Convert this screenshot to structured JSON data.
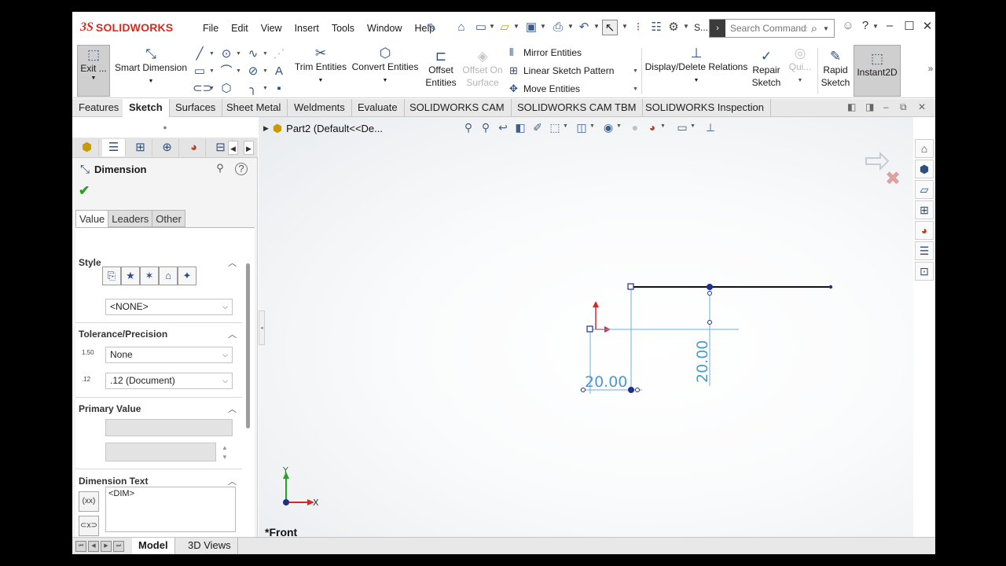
{
  "app": {
    "logo_mark": "3S",
    "logo_text": "SOLIDWORKS"
  },
  "menu": [
    "File",
    "Edit",
    "View",
    "Insert",
    "Tools",
    "Window",
    "Help"
  ],
  "toolbar": {
    "s_label": "S...",
    "search_placeholder": "Search Commands"
  },
  "ribbon": {
    "exit_label": "Exit ...",
    "smart_dimension": "Smart Dimension",
    "trim_entities": "Trim Entities",
    "convert_entities": "Convert Entities",
    "offset_entities_1": "Offset",
    "offset_entities_2": "Entities",
    "offset_surface_1": "Offset On",
    "offset_surface_2": "Surface",
    "mirror_entities": "Mirror Entities",
    "linear_pattern": "Linear Sketch Pattern",
    "move_entities": "Move Entities",
    "display_delete": "Display/Delete Relations",
    "repair_1": "Repair",
    "repair_2": "Sketch",
    "quick": "Qui...",
    "rapid_1": "Rapid",
    "rapid_2": "Sketch",
    "instant2d": "Instant2D",
    "more": "»"
  },
  "tabs": [
    "Features",
    "Sketch",
    "Surfaces",
    "Sheet Metal",
    "Weldments",
    "Evaluate",
    "SOLIDWORKS CAM",
    "SOLIDWORKS CAM TBM",
    "SOLIDWORKS Inspection"
  ],
  "active_tab": "Sketch",
  "property_manager": {
    "title": "Dimension",
    "subtabs": [
      "Value",
      "Leaders",
      "Other"
    ],
    "style": {
      "title": "Style",
      "value": "<NONE>"
    },
    "tolerance": {
      "title": "Tolerance/Precision",
      "tol_value": "None",
      "precision_value": ".12 (Document)",
      "tol_icon_text": "1.50",
      "prec_icon_text": ".12"
    },
    "primary_value": {
      "title": "Primary Value"
    },
    "dimension_text": {
      "title": "Dimension Text",
      "value": "<DIM>"
    }
  },
  "graphics": {
    "tree_label": "Part2  (Default<<De...",
    "view_label": "*Front",
    "dim_horizontal": "20.00",
    "dim_vertical": "20.00",
    "triad_x": "X",
    "triad_y": "Y"
  },
  "bottom_tabs": [
    "Model",
    "3D Views"
  ],
  "colors": {
    "accent": "#d52b1e",
    "dimension": "#4a9bcc",
    "sketch_line": "#111111",
    "point": "#1c2f8f",
    "origin": "#d9262a"
  }
}
